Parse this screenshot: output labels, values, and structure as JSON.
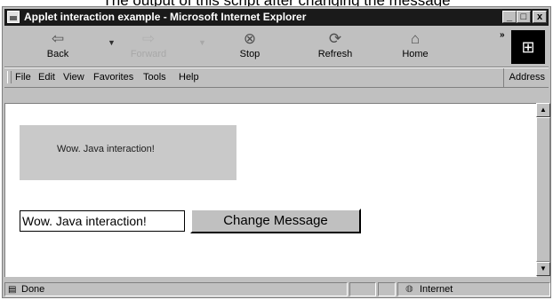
{
  "caption": "The output of this script after changing the message",
  "window": {
    "title": "Applet interaction example - Microsoft Internet Explorer",
    "controls": {
      "minimize": "_",
      "maximize": "□",
      "close": "x"
    }
  },
  "toolbar": {
    "back": "Back",
    "forward": "Forward",
    "stop": "Stop",
    "refresh": "Refresh",
    "home": "Home",
    "more": "»",
    "icons": {
      "back": "back-arrow-icon",
      "forward": "forward-arrow-icon",
      "stop": "stop-icon",
      "refresh": "refresh-icon",
      "home": "home-icon",
      "logo": "windows-logo-icon"
    }
  },
  "menu": {
    "file": "File",
    "edit": "Edit",
    "view": "View",
    "favorites": "Favorites",
    "tools": "Tools",
    "help": "Help",
    "address": "Address"
  },
  "page": {
    "applet_message": "Wow. Java interaction!",
    "text_field_value": "Wow. Java interaction!",
    "button_label": "Change Message"
  },
  "status": {
    "text": "Done",
    "zone": "Internet"
  }
}
